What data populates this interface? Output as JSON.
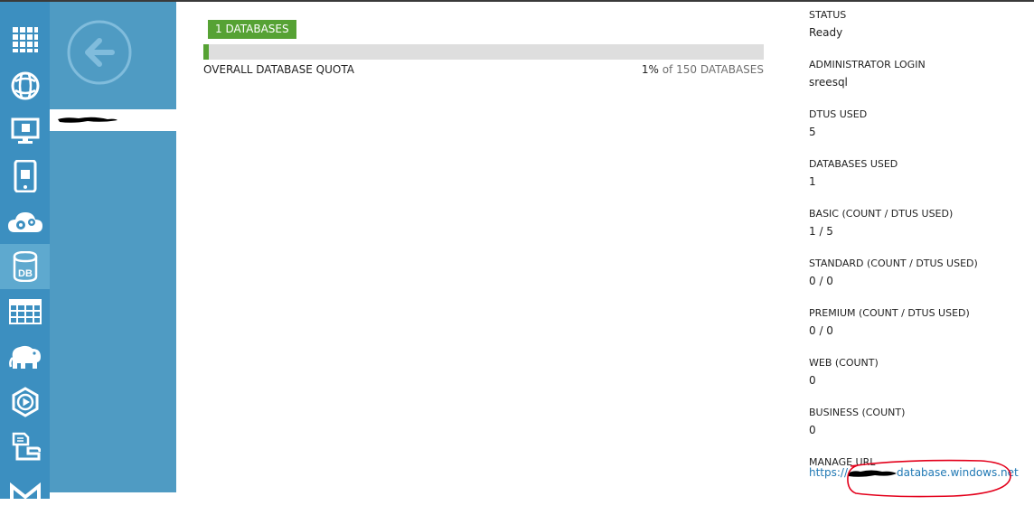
{
  "nav": {
    "items": [
      {
        "icon": "all-items-grid-icon",
        "label": ""
      },
      {
        "icon": "web-sites-globe-icon",
        "label": ""
      },
      {
        "icon": "virtual-machines-monitor-icon",
        "label": ""
      },
      {
        "icon": "mobile-services-phone-icon",
        "label": ""
      },
      {
        "icon": "cloud-services-gears-icon",
        "label": ""
      },
      {
        "icon": "sql-databases-db-icon",
        "label": "DB"
      },
      {
        "icon": "storage-table-icon",
        "label": ""
      },
      {
        "icon": "hdinsight-elephant-icon",
        "label": ""
      },
      {
        "icon": "media-services-play-icon",
        "label": ""
      },
      {
        "icon": "service-bus-icon",
        "label": ""
      },
      {
        "icon": "visual-studio-icon",
        "label": ""
      }
    ],
    "active_index": 5
  },
  "panel": {
    "back_icon": "back-arrow-icon"
  },
  "quota": {
    "badge_label": "1 DATABASES",
    "title": "OVERALL DATABASE QUOTA",
    "percent_text": "1%",
    "of_text": "of 150 DATABASES",
    "fill_fraction": 0.01
  },
  "properties": [
    {
      "label": "STATUS",
      "value": "Ready"
    },
    {
      "label": "ADMINISTRATOR LOGIN",
      "value": "sreesql"
    },
    {
      "label": "DTUS USED",
      "value": "5"
    },
    {
      "label": "DATABASES USED",
      "value": "1"
    },
    {
      "label": "BASIC (COUNT / DTUS USED)",
      "value": "1 / 5"
    },
    {
      "label": "STANDARD (COUNT / DTUS USED)",
      "value": "0 / 0"
    },
    {
      "label": "PREMIUM (COUNT / DTUS USED)",
      "value": "0 / 0"
    },
    {
      "label": "WEB (COUNT)",
      "value": "0"
    },
    {
      "label": "BUSINESS (COUNT)",
      "value": "0"
    }
  ],
  "manage_url": {
    "label": "MANAGE URL",
    "prefix": "https://",
    "suffix": "database.windows.net"
  },
  "colors": {
    "accent_green": "#56a234",
    "nav_blue": "#3c8fc0",
    "panel_blue": "#4f9bc3",
    "link_blue": "#1f78b4",
    "annotation_red": "#e3001b"
  }
}
